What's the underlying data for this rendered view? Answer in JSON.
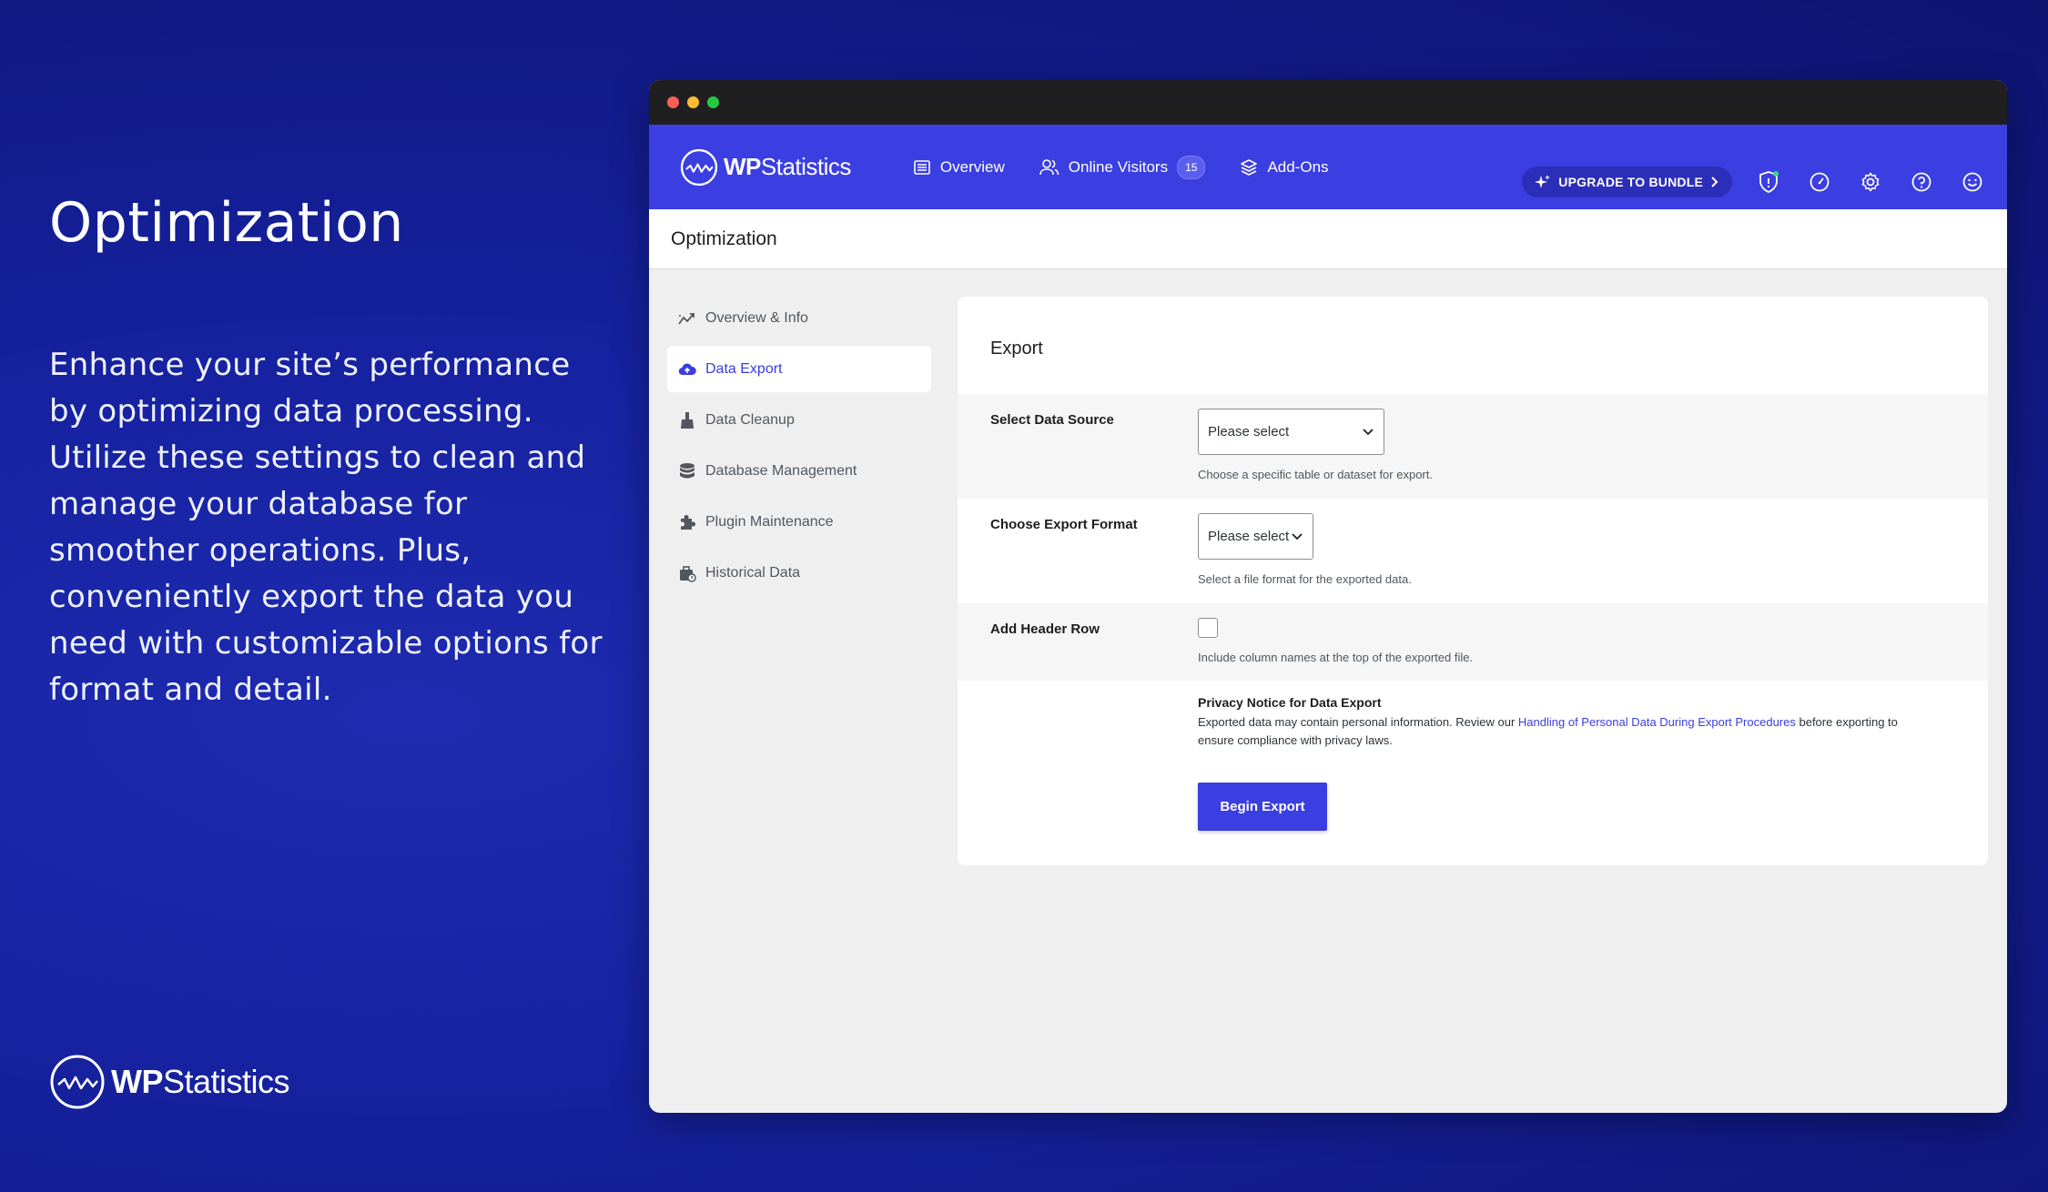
{
  "promo": {
    "title": "Optimization",
    "text": "Enhance your site’s performance by optimizing data processing. Utilize these settings to clean and manage your database for smoother operations. Plus, conveniently export the data you need with customizable options for format and detail."
  },
  "brand": {
    "name_bold": "WP",
    "name_rest": "Statistics"
  },
  "nav": {
    "overview": "Overview",
    "online_visitors": "Online Visitors",
    "online_count": "15",
    "addons": "Add-Ons",
    "upgrade": "UPGRADE TO BUNDLE"
  },
  "page": {
    "title": "Optimization"
  },
  "sidebar": {
    "items": [
      {
        "label": "Overview & Info"
      },
      {
        "label": "Data Export"
      },
      {
        "label": "Data Cleanup"
      },
      {
        "label": "Database Management"
      },
      {
        "label": "Plugin Maintenance"
      },
      {
        "label": "Historical Data"
      }
    ]
  },
  "export": {
    "title": "Export",
    "data_source": {
      "label": "Select Data Source",
      "value": "Please select",
      "hint": "Choose a specific table or dataset for export."
    },
    "format": {
      "label": "Choose Export Format",
      "value": "Please select",
      "hint": "Select a file format for the exported data."
    },
    "header_row": {
      "label": "Add Header Row",
      "hint": "Include column names at the top of the exported file."
    },
    "privacy": {
      "title": "Privacy Notice for Data Export",
      "text_before": "Exported data may contain personal information. Review our ",
      "link": "Handling of Personal Data During Export Procedures",
      "text_after": " before exporting to ensure compliance with privacy laws."
    },
    "button": "Begin Export"
  },
  "colors": {
    "accent": "#3b3ee0",
    "background": "#1622a0"
  }
}
